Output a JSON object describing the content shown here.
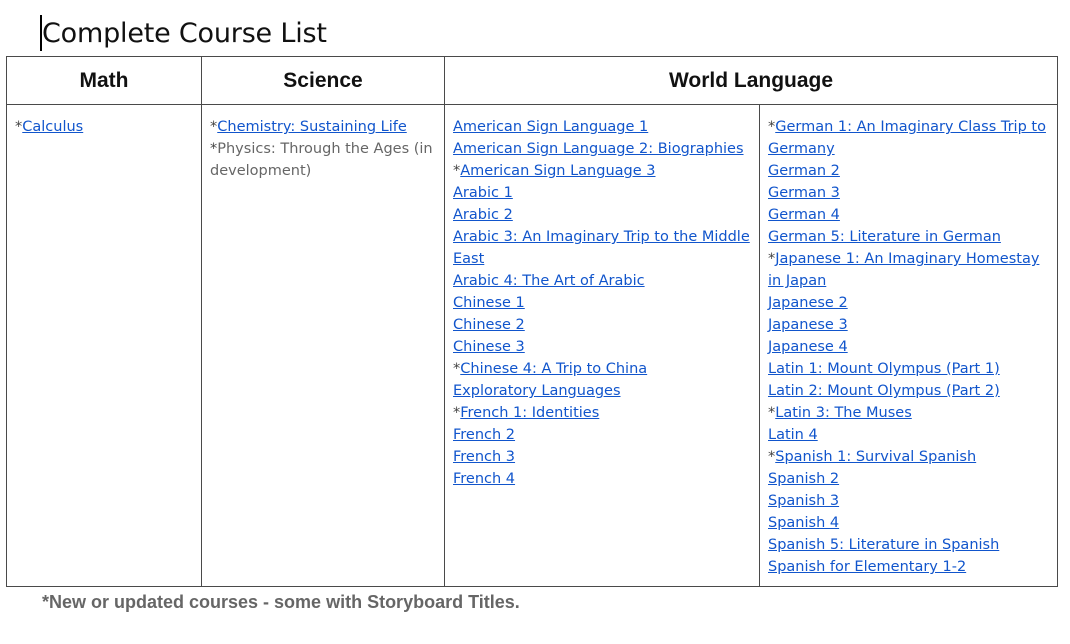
{
  "page": {
    "title": "Complete Course List",
    "footnote": "*New or updated courses - some with Storyboard Titles."
  },
  "table": {
    "headers": {
      "math": "Math",
      "science": "Science",
      "world_language": "World Language"
    },
    "math": [
      {
        "star": true,
        "text": "Calculus",
        "link": true
      }
    ],
    "science": [
      {
        "star": true,
        "text": "Chemistry: Sustaining Life",
        "link": true
      },
      {
        "star": true,
        "text": "Physics: Through the Ages (in development)",
        "link": false
      }
    ],
    "world_language_col1": [
      {
        "star": false,
        "text": "American Sign Language 1",
        "link": true
      },
      {
        "star": false,
        "text": "American Sign Language 2: Biographies",
        "link": true
      },
      {
        "star": true,
        "text": "American Sign Language 3",
        "link": true
      },
      {
        "star": false,
        "text": "Arabic 1",
        "link": true
      },
      {
        "star": false,
        "text": "Arabic 2",
        "link": true
      },
      {
        "star": false,
        "text": "Arabic 3: An Imaginary Trip to the Middle East",
        "link": true
      },
      {
        "star": false,
        "text": "Arabic 4: The Art of Arabic",
        "link": true
      },
      {
        "star": false,
        "text": "Chinese 1",
        "link": true
      },
      {
        "star": false,
        "text": "Chinese 2",
        "link": true
      },
      {
        "star": false,
        "text": "Chinese 3",
        "link": true
      },
      {
        "star": true,
        "text": "Chinese 4: A Trip to China",
        "link": true
      },
      {
        "star": false,
        "text": "Exploratory Languages",
        "link": true
      },
      {
        "star": true,
        "text": "French 1: Identities",
        "link": true
      },
      {
        "star": false,
        "text": "French 2",
        "link": true
      },
      {
        "star": false,
        "text": "French 3",
        "link": true
      },
      {
        "star": false,
        "text": "French 4",
        "link": true
      }
    ],
    "world_language_col2": [
      {
        "star": true,
        "text": "German 1: An Imaginary Class Trip to Germany",
        "link": true
      },
      {
        "star": false,
        "text": "German 2",
        "link": true
      },
      {
        "star": false,
        "text": "German 3",
        "link": true
      },
      {
        "star": false,
        "text": "German 4",
        "link": true
      },
      {
        "star": false,
        "text": "German 5: Literature in German",
        "link": true
      },
      {
        "star": true,
        "text": "Japanese 1: An Imaginary Homestay in Japan",
        "link": true
      },
      {
        "star": false,
        "text": "Japanese 2",
        "link": true
      },
      {
        "star": false,
        "text": "Japanese 3",
        "link": true
      },
      {
        "star": false,
        "text": "Japanese 4",
        "link": true
      },
      {
        "star": false,
        "text": "Latin 1: Mount Olympus (Part 1)",
        "link": true
      },
      {
        "star": false,
        "text": "Latin 2: Mount Olympus (Part 2)",
        "link": true
      },
      {
        "star": true,
        "text": "Latin 3: The Muses",
        "link": true
      },
      {
        "star": false,
        "text": "Latin 4",
        "link": true
      },
      {
        "star": true,
        "text": "Spanish 1: Survival Spanish",
        "link": true
      },
      {
        "star": false,
        "text": "Spanish 2",
        "link": true
      },
      {
        "star": false,
        "text": "Spanish 3",
        "link": true
      },
      {
        "star": false,
        "text": "Spanish 4",
        "link": true
      },
      {
        "star": false,
        "text": "Spanish 5: Literature in Spanish",
        "link": true
      },
      {
        "star": false,
        "text": "Spanish for Elementary 1-2",
        "link": true
      }
    ]
  },
  "colors": {
    "link": "#1155cc",
    "muted_text": "#666666",
    "border": "#4a4a4a"
  }
}
